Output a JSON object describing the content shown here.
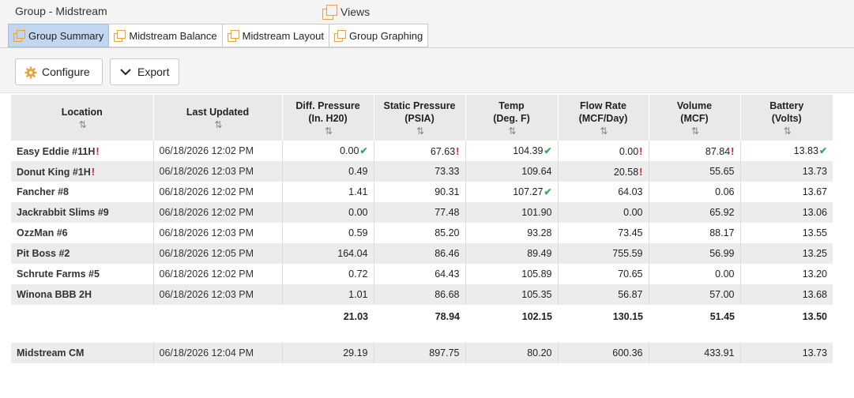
{
  "header": {
    "title": "Group - Midstream",
    "views_label": "Views"
  },
  "tabs": [
    {
      "label": "Group Summary",
      "active": true
    },
    {
      "label": "Midstream Balance",
      "active": false
    },
    {
      "label": "Midstream Layout",
      "active": false
    },
    {
      "label": "Group Graphing",
      "active": false
    }
  ],
  "toolbar": {
    "configure_label": "Configure",
    "export_label": "Export"
  },
  "table": {
    "columns": [
      {
        "line1": "Location",
        "line2": ""
      },
      {
        "line1": "Last Updated",
        "line2": ""
      },
      {
        "line1": "Diff. Pressure",
        "line2": "(In. H20)"
      },
      {
        "line1": "Static Pressure",
        "line2": "(PSIA)"
      },
      {
        "line1": "Temp",
        "line2": "(Deg. F)"
      },
      {
        "line1": "Flow Rate",
        "line2": "(MCF/Day)"
      },
      {
        "line1": "Volume",
        "line2": "(MCF)"
      },
      {
        "line1": "Battery",
        "line2": "(Volts)"
      }
    ],
    "sort_glyph": "⇅",
    "rows": [
      {
        "location": "Easy Eddie #11H",
        "location_flag": "!",
        "updated": "06/18/2026 12:02 PM",
        "diff": "0.00",
        "diff_mark": "✔",
        "static": "67.63",
        "static_mark": "!",
        "temp": "104.39",
        "temp_mark": "✔",
        "flow": "0.00",
        "flow_mark": "!",
        "volume": "87.84",
        "volume_mark": "!",
        "battery": "13.83",
        "battery_mark": "✔"
      },
      {
        "location": "Donut King #1H",
        "location_flag": "!",
        "updated": "06/18/2026 12:03 PM",
        "diff": "0.49",
        "diff_mark": "",
        "static": "73.33",
        "static_mark": "",
        "temp": "109.64",
        "temp_mark": "",
        "flow": "20.58",
        "flow_mark": "!",
        "volume": "55.65",
        "volume_mark": "",
        "battery": "13.73",
        "battery_mark": ""
      },
      {
        "location": "Fancher #8",
        "location_flag": "",
        "updated": "06/18/2026 12:02 PM",
        "diff": "1.41",
        "diff_mark": "",
        "static": "90.31",
        "static_mark": "",
        "temp": "107.27",
        "temp_mark": "✔",
        "flow": "64.03",
        "flow_mark": "",
        "volume": "0.06",
        "volume_mark": "",
        "battery": "13.67",
        "battery_mark": ""
      },
      {
        "location": "Jackrabbit Slims #9",
        "location_flag": "",
        "updated": "06/18/2026 12:02 PM",
        "diff": "0.00",
        "diff_mark": "",
        "static": "77.48",
        "static_mark": "",
        "temp": "101.90",
        "temp_mark": "",
        "flow": "0.00",
        "flow_mark": "",
        "volume": "65.92",
        "volume_mark": "",
        "battery": "13.06",
        "battery_mark": ""
      },
      {
        "location": "OzzMan #6",
        "location_flag": "",
        "updated": "06/18/2026 12:03 PM",
        "diff": "0.59",
        "diff_mark": "",
        "static": "85.20",
        "static_mark": "",
        "temp": "93.28",
        "temp_mark": "",
        "flow": "73.45",
        "flow_mark": "",
        "volume": "88.17",
        "volume_mark": "",
        "battery": "13.55",
        "battery_mark": ""
      },
      {
        "location": "Pit Boss #2",
        "location_flag": "",
        "updated": "06/18/2026 12:05 PM",
        "diff": "164.04",
        "diff_mark": "",
        "static": "86.46",
        "static_mark": "",
        "temp": "89.49",
        "temp_mark": "",
        "flow": "755.59",
        "flow_mark": "",
        "volume": "56.99",
        "volume_mark": "",
        "battery": "13.25",
        "battery_mark": ""
      },
      {
        "location": "Schrute Farms #5",
        "location_flag": "",
        "updated": "06/18/2026 12:02 PM",
        "diff": "0.72",
        "diff_mark": "",
        "static": "64.43",
        "static_mark": "",
        "temp": "105.89",
        "temp_mark": "",
        "flow": "70.65",
        "flow_mark": "",
        "volume": "0.00",
        "volume_mark": "",
        "battery": "13.20",
        "battery_mark": ""
      },
      {
        "location": "Winona BBB 2H",
        "location_flag": "",
        "updated": "06/18/2026 12:03 PM",
        "diff": "1.01",
        "diff_mark": "",
        "static": "86.68",
        "static_mark": "",
        "temp": "105.35",
        "temp_mark": "",
        "flow": "56.87",
        "flow_mark": "",
        "volume": "57.00",
        "volume_mark": "",
        "battery": "13.68",
        "battery_mark": ""
      }
    ],
    "averages": {
      "diff": "21.03",
      "static": "78.94",
      "temp": "102.15",
      "flow": "130.15",
      "volume": "51.45",
      "battery": "13.50"
    },
    "midstream": {
      "location": "Midstream CM",
      "updated": "06/18/2026 12:04 PM",
      "diff": "29.19",
      "static": "897.75",
      "temp": "80.20",
      "flow": "600.36",
      "volume": "433.91",
      "battery": "13.73"
    }
  },
  "colors": {
    "flag": "#d62020",
    "ok": "#36a852",
    "tab_active": "#c3d6ef",
    "icon_accent": "#e8a33d"
  }
}
